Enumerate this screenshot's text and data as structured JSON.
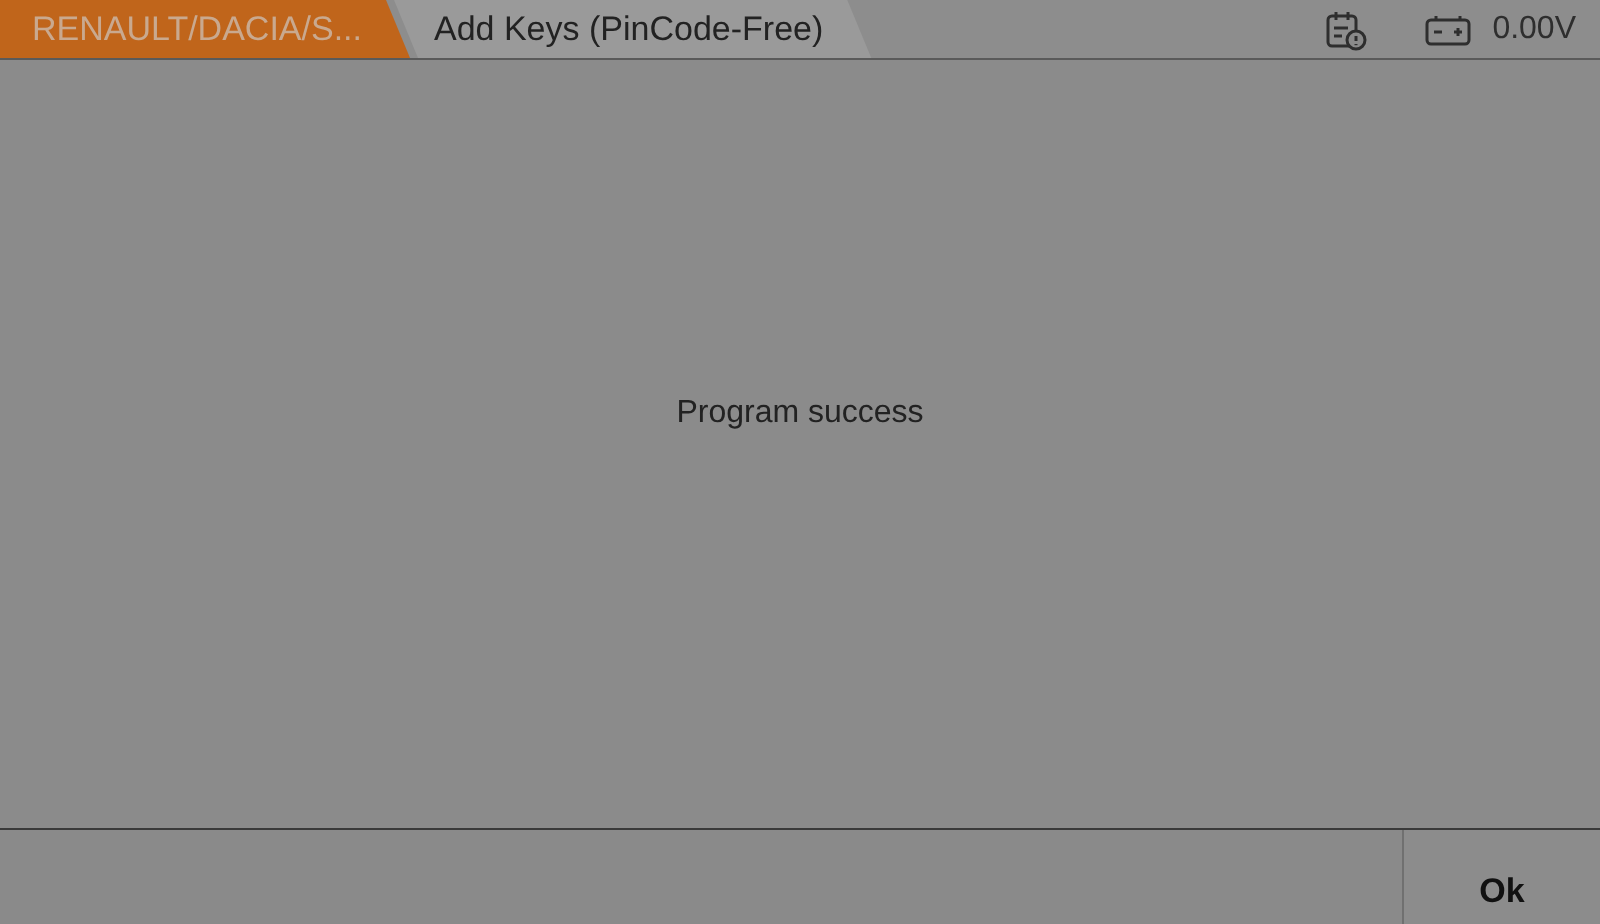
{
  "breadcrumbs": [
    {
      "label": "RENAULT/DACIA/S...",
      "kind": "root"
    },
    {
      "label": "Add Keys (PinCode-Free)",
      "kind": "current"
    }
  ],
  "status": {
    "voltage": "0.00V"
  },
  "message": "Program success",
  "buttons": [
    "Ok"
  ]
}
